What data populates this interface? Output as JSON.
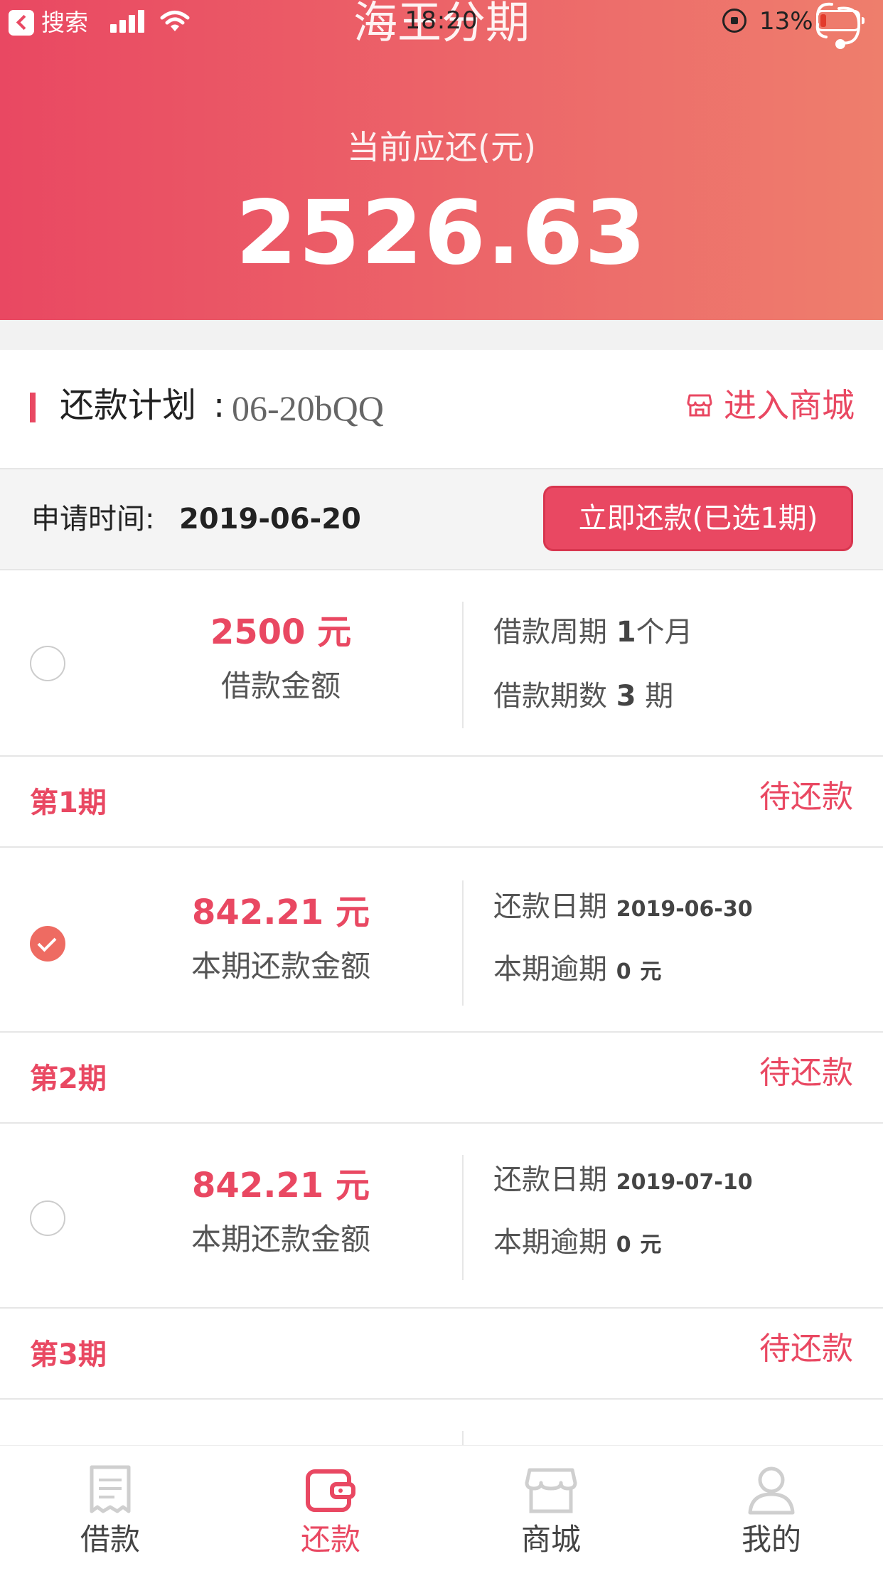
{
  "status_bar": {
    "back_app": "搜索",
    "time": "18:20",
    "battery": "13%"
  },
  "header": {
    "title": "海王分期",
    "label": "当前应还(元)",
    "amount": "2526.63"
  },
  "plan": {
    "title": "还款计划",
    "colon": ":",
    "code": "06-20bQQ",
    "mall_link": "进入商城"
  },
  "application": {
    "label": "申请时间:",
    "date": "2019-06-20",
    "pay_button": "立即还款(已选1期)"
  },
  "loan_summary": {
    "amount": "2500 元",
    "amount_label": "借款金额",
    "period_label": "借款周期",
    "period_value": "1",
    "period_unit": "个月",
    "count_label": "借款期数",
    "count_value": "3",
    "count_unit": "期"
  },
  "periods": [
    {
      "label": "第1期",
      "status": "待还款",
      "amount": "842.21 元",
      "amount_label": "本期还款金额",
      "date_label": "还款日期",
      "date": "2019-06-30",
      "overdue_label": "本期逾期",
      "overdue_value": "0",
      "overdue_unit": "元",
      "selected": true
    },
    {
      "label": "第2期",
      "status": "待还款",
      "amount": "842.21 元",
      "amount_label": "本期还款金额",
      "date_label": "还款日期",
      "date": "2019-07-10",
      "overdue_label": "本期逾期",
      "overdue_value": "0",
      "overdue_unit": "元",
      "selected": false
    },
    {
      "label": "第3期",
      "status": "待还款"
    }
  ],
  "tabbar": {
    "items": [
      {
        "label": "借款",
        "icon": "loan-icon",
        "active": false
      },
      {
        "label": "还款",
        "icon": "wallet-icon",
        "active": true
      },
      {
        "label": "商城",
        "icon": "shop-icon",
        "active": false
      },
      {
        "label": "我的",
        "icon": "user-icon",
        "active": false
      }
    ]
  },
  "colors": {
    "accent": "#e94862",
    "gradient_end": "#ee7e6c",
    "check": "#ee6b62"
  }
}
